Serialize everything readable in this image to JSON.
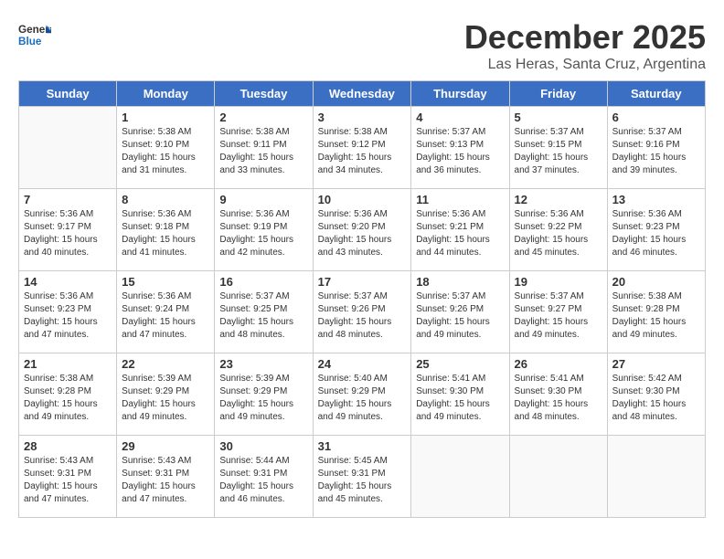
{
  "logo": {
    "general": "General",
    "blue": "Blue"
  },
  "header": {
    "month": "December 2025",
    "location": "Las Heras, Santa Cruz, Argentina"
  },
  "days_of_week": [
    "Sunday",
    "Monday",
    "Tuesday",
    "Wednesday",
    "Thursday",
    "Friday",
    "Saturday"
  ],
  "weeks": [
    [
      {
        "day": "",
        "info": ""
      },
      {
        "day": "1",
        "info": "Sunrise: 5:38 AM\nSunset: 9:10 PM\nDaylight: 15 hours\nand 31 minutes."
      },
      {
        "day": "2",
        "info": "Sunrise: 5:38 AM\nSunset: 9:11 PM\nDaylight: 15 hours\nand 33 minutes."
      },
      {
        "day": "3",
        "info": "Sunrise: 5:38 AM\nSunset: 9:12 PM\nDaylight: 15 hours\nand 34 minutes."
      },
      {
        "day": "4",
        "info": "Sunrise: 5:37 AM\nSunset: 9:13 PM\nDaylight: 15 hours\nand 36 minutes."
      },
      {
        "day": "5",
        "info": "Sunrise: 5:37 AM\nSunset: 9:15 PM\nDaylight: 15 hours\nand 37 minutes."
      },
      {
        "day": "6",
        "info": "Sunrise: 5:37 AM\nSunset: 9:16 PM\nDaylight: 15 hours\nand 39 minutes."
      }
    ],
    [
      {
        "day": "7",
        "info": "Sunrise: 5:36 AM\nSunset: 9:17 PM\nDaylight: 15 hours\nand 40 minutes."
      },
      {
        "day": "8",
        "info": "Sunrise: 5:36 AM\nSunset: 9:18 PM\nDaylight: 15 hours\nand 41 minutes."
      },
      {
        "day": "9",
        "info": "Sunrise: 5:36 AM\nSunset: 9:19 PM\nDaylight: 15 hours\nand 42 minutes."
      },
      {
        "day": "10",
        "info": "Sunrise: 5:36 AM\nSunset: 9:20 PM\nDaylight: 15 hours\nand 43 minutes."
      },
      {
        "day": "11",
        "info": "Sunrise: 5:36 AM\nSunset: 9:21 PM\nDaylight: 15 hours\nand 44 minutes."
      },
      {
        "day": "12",
        "info": "Sunrise: 5:36 AM\nSunset: 9:22 PM\nDaylight: 15 hours\nand 45 minutes."
      },
      {
        "day": "13",
        "info": "Sunrise: 5:36 AM\nSunset: 9:23 PM\nDaylight: 15 hours\nand 46 minutes."
      }
    ],
    [
      {
        "day": "14",
        "info": "Sunrise: 5:36 AM\nSunset: 9:23 PM\nDaylight: 15 hours\nand 47 minutes."
      },
      {
        "day": "15",
        "info": "Sunrise: 5:36 AM\nSunset: 9:24 PM\nDaylight: 15 hours\nand 47 minutes."
      },
      {
        "day": "16",
        "info": "Sunrise: 5:37 AM\nSunset: 9:25 PM\nDaylight: 15 hours\nand 48 minutes."
      },
      {
        "day": "17",
        "info": "Sunrise: 5:37 AM\nSunset: 9:26 PM\nDaylight: 15 hours\nand 48 minutes."
      },
      {
        "day": "18",
        "info": "Sunrise: 5:37 AM\nSunset: 9:26 PM\nDaylight: 15 hours\nand 49 minutes."
      },
      {
        "day": "19",
        "info": "Sunrise: 5:37 AM\nSunset: 9:27 PM\nDaylight: 15 hours\nand 49 minutes."
      },
      {
        "day": "20",
        "info": "Sunrise: 5:38 AM\nSunset: 9:28 PM\nDaylight: 15 hours\nand 49 minutes."
      }
    ],
    [
      {
        "day": "21",
        "info": "Sunrise: 5:38 AM\nSunset: 9:28 PM\nDaylight: 15 hours\nand 49 minutes."
      },
      {
        "day": "22",
        "info": "Sunrise: 5:39 AM\nSunset: 9:29 PM\nDaylight: 15 hours\nand 49 minutes."
      },
      {
        "day": "23",
        "info": "Sunrise: 5:39 AM\nSunset: 9:29 PM\nDaylight: 15 hours\nand 49 minutes."
      },
      {
        "day": "24",
        "info": "Sunrise: 5:40 AM\nSunset: 9:29 PM\nDaylight: 15 hours\nand 49 minutes."
      },
      {
        "day": "25",
        "info": "Sunrise: 5:41 AM\nSunset: 9:30 PM\nDaylight: 15 hours\nand 49 minutes."
      },
      {
        "day": "26",
        "info": "Sunrise: 5:41 AM\nSunset: 9:30 PM\nDaylight: 15 hours\nand 48 minutes."
      },
      {
        "day": "27",
        "info": "Sunrise: 5:42 AM\nSunset: 9:30 PM\nDaylight: 15 hours\nand 48 minutes."
      }
    ],
    [
      {
        "day": "28",
        "info": "Sunrise: 5:43 AM\nSunset: 9:31 PM\nDaylight: 15 hours\nand 47 minutes."
      },
      {
        "day": "29",
        "info": "Sunrise: 5:43 AM\nSunset: 9:31 PM\nDaylight: 15 hours\nand 47 minutes."
      },
      {
        "day": "30",
        "info": "Sunrise: 5:44 AM\nSunset: 9:31 PM\nDaylight: 15 hours\nand 46 minutes."
      },
      {
        "day": "31",
        "info": "Sunrise: 5:45 AM\nSunset: 9:31 PM\nDaylight: 15 hours\nand 45 minutes."
      },
      {
        "day": "",
        "info": ""
      },
      {
        "day": "",
        "info": ""
      },
      {
        "day": "",
        "info": ""
      }
    ]
  ]
}
